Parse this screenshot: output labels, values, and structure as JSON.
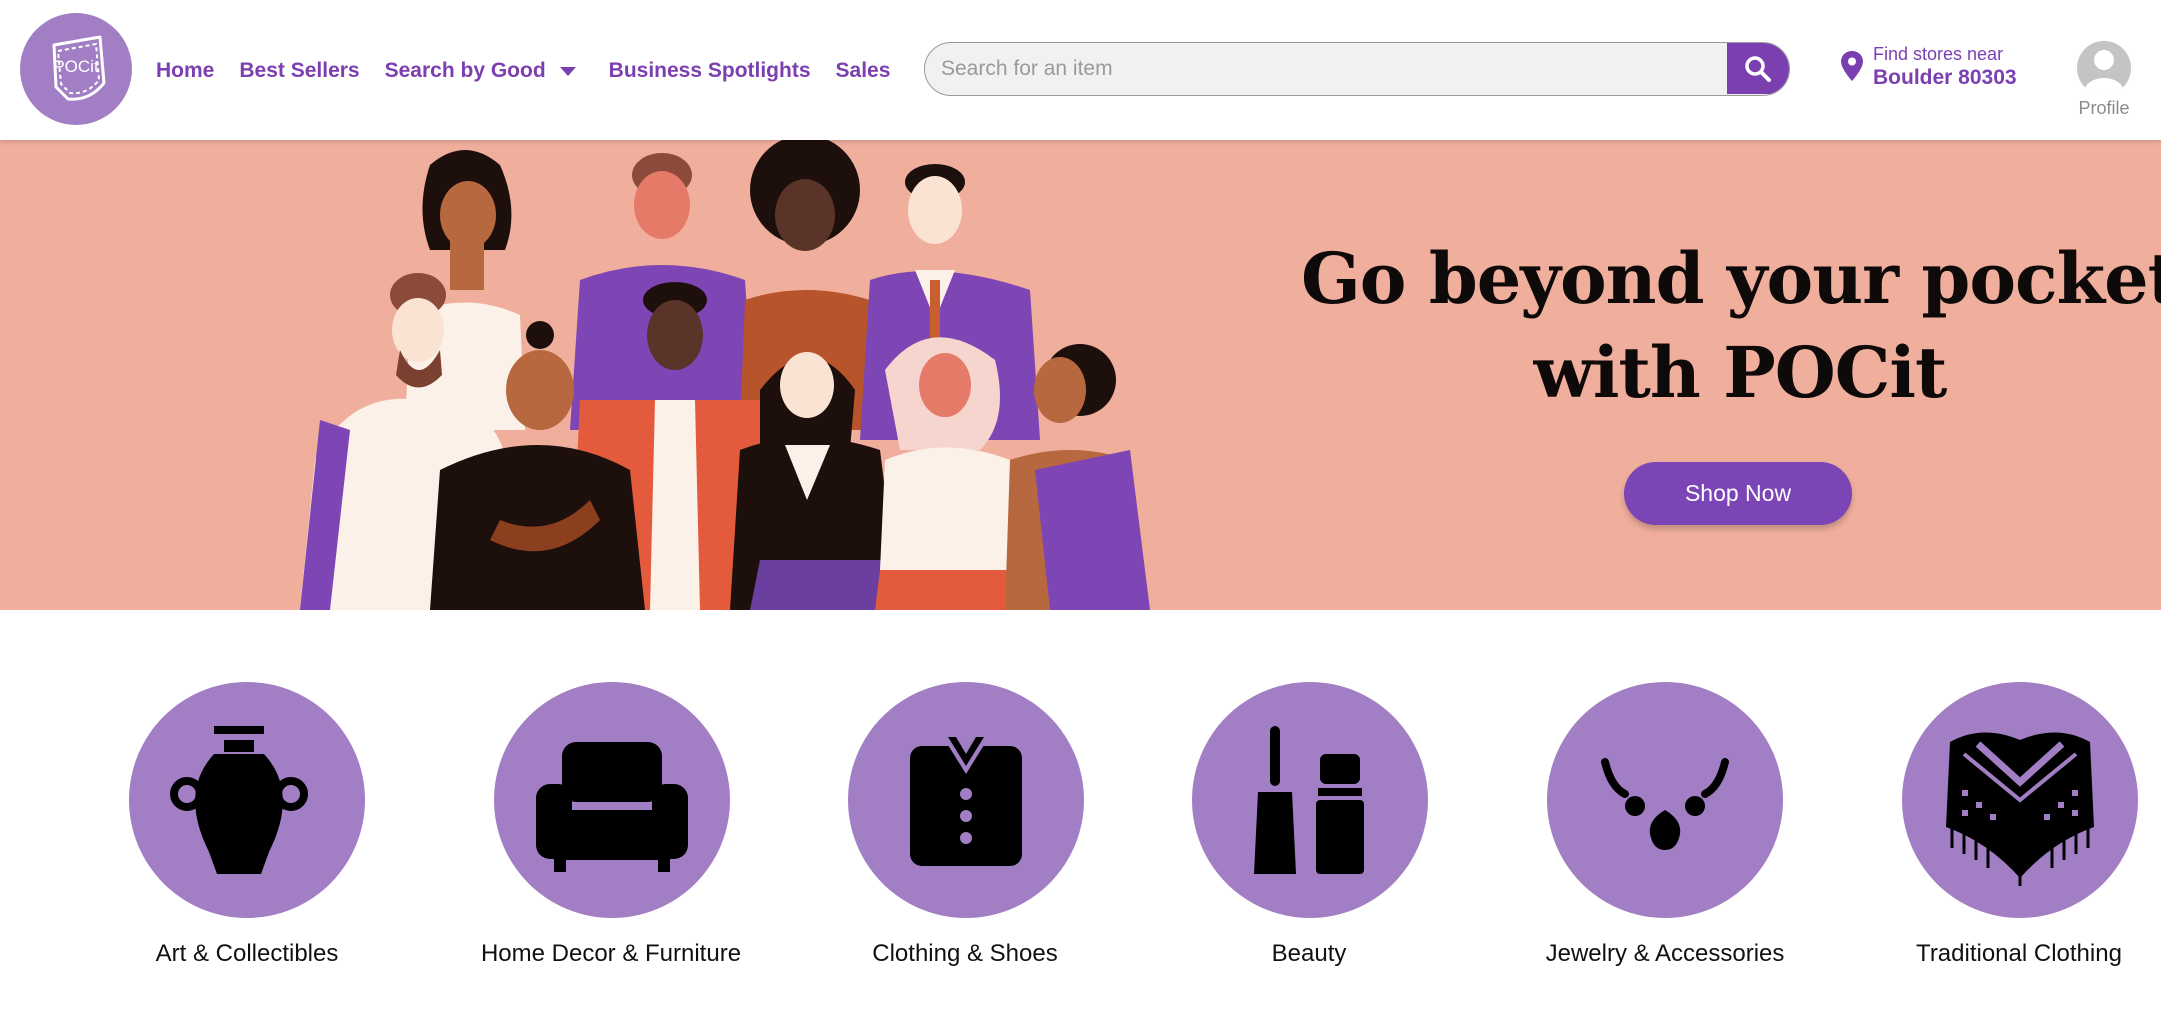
{
  "header": {
    "logo_text": "POCit",
    "nav": {
      "home": "Home",
      "best_sellers": "Best Sellers",
      "search_by_good": "Search by Good",
      "business_spotlights": "Business Spotlights",
      "sales": "Sales"
    },
    "search": {
      "placeholder": "Search for an item",
      "value": ""
    },
    "location": {
      "label": "Find stores near",
      "place": "Boulder 80303"
    },
    "profile_label": "Profile"
  },
  "hero": {
    "title_line1": "Go beyond your pocket",
    "title_line2": "with POCit",
    "cta": "Shop Now",
    "background_color": "#f0ae9d"
  },
  "categories": [
    {
      "label": "Art & Collectibles",
      "icon": "vase-icon"
    },
    {
      "label": "Home Decor & Furniture",
      "icon": "armchair-icon"
    },
    {
      "label": "Clothing & Shoes",
      "icon": "shirt-icon"
    },
    {
      "label": "Beauty",
      "icon": "mascara-icon"
    },
    {
      "label": "Jewelry & Accessories",
      "icon": "necklace-icon"
    },
    {
      "label": "Traditional Clothing",
      "icon": "poncho-icon"
    }
  ],
  "colors": {
    "accent": "#7b3fb0",
    "circle": "#a27fc4",
    "button": "#7b45b5"
  }
}
